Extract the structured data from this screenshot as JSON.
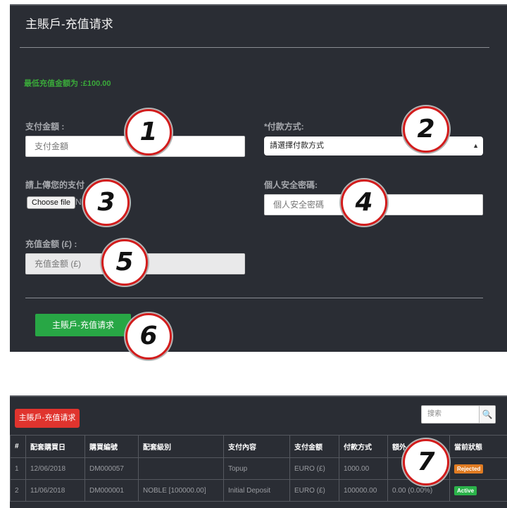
{
  "form": {
    "title": "主賬戶-充值请求",
    "min_message": "最低充值金额为 :£100.00",
    "amount_label": "支付金額 :",
    "amount_placeholder": "支付金額",
    "method_label": "*付款方式:",
    "method_selected": "請選擇付款方式",
    "upload_label": "請上傳您的支付",
    "choose_file": "Choose file",
    "file_status": "N",
    "pin_label": "個人安全密碼:",
    "pin_placeholder": "個人安全密碼",
    "topup_label": "充值金额 (£) :",
    "topup_placeholder": "充值金额 (£)",
    "submit_label": "主賬戶-充值请求"
  },
  "callouts": [
    "1",
    "2",
    "3",
    "4",
    "5",
    "6",
    "7"
  ],
  "table": {
    "button_label": "主賬戶-充值请求",
    "search_placeholder": "搜索",
    "headers": [
      "#",
      "配套購買日",
      "購買編號",
      "配套級別",
      "支付內容",
      "支付金额",
      "付款方式",
      "額外",
      "當前狀態"
    ],
    "rows": [
      [
        "1",
        "12/06/2018",
        "DM000057",
        "",
        "Topup",
        "EURO (£)",
        "1000.00",
        "",
        "Rejected"
      ],
      [
        "2",
        "11/06/2018",
        "DM000001",
        "NOBLE [100000.00]",
        "Initial Deposit",
        "EURO (£)",
        "100000.00",
        "0.00 (0.00%)",
        "Active"
      ]
    ]
  },
  "colors": {
    "panel": "#2a2d34",
    "green": "#28a745",
    "red": "#e0342e",
    "rejected": "#e07b22",
    "active": "#2bb34a",
    "callout_ring": "#d21c1c"
  }
}
